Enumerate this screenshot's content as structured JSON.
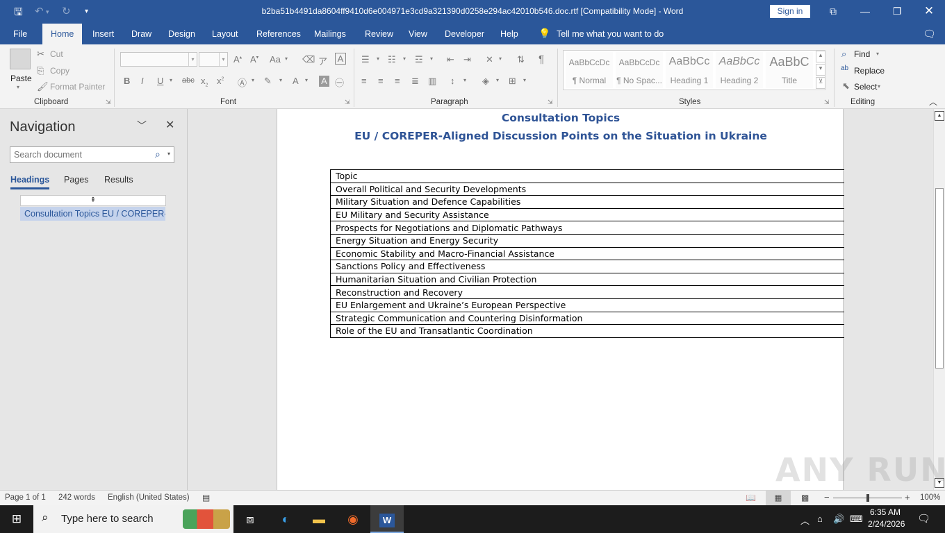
{
  "titlebar": {
    "title": "b2ba51b4491da8604ff9410d6e004971e3cd9a321390d0258e294ac42010b546.doc.rtf  [Compatibility Mode]  -  Word",
    "signin": "Sign in"
  },
  "tabs": [
    "File",
    "Home",
    "Insert",
    "Draw",
    "Design",
    "Layout",
    "References",
    "Mailings",
    "Review",
    "View",
    "Developer",
    "Help"
  ],
  "tell_me": "Tell me what you want to do",
  "ribbon": {
    "clipboard": {
      "label": "Clipboard",
      "paste": "Paste",
      "cut": "Cut",
      "copy": "Copy",
      "format_painter": "Format Painter"
    },
    "font": {
      "label": "Font"
    },
    "paragraph": {
      "label": "Paragraph"
    },
    "styles": {
      "label": "Styles",
      "items": [
        {
          "preview": "AaBbCcDc",
          "name": "¶ Normal"
        },
        {
          "preview": "AaBbCcDc",
          "name": "¶ No Spac..."
        },
        {
          "preview": "AaBbCc",
          "name": "Heading 1"
        },
        {
          "preview": "AaBbCc",
          "name": "Heading 2"
        },
        {
          "preview": "AaBbC",
          "name": "Title"
        }
      ]
    },
    "editing": {
      "label": "Editing",
      "find": "Find",
      "replace": "Replace",
      "select": "Select"
    }
  },
  "nav": {
    "title": "Navigation",
    "search_placeholder": "Search document",
    "tabs": [
      "Headings",
      "Pages",
      "Results"
    ],
    "heading_item": "Consultation Topics EU / COREPER-..."
  },
  "document": {
    "heading1": "Consultation Topics",
    "heading2": "EU / COREPER-Aligned Discussion Points on the Situation in Ukraine",
    "table_rows": [
      "Topic",
      "Overall Political and Security Developments",
      "Military Situation and Defence Capabilities",
      "EU Military and Security Assistance",
      "Prospects for Negotiations and Diplomatic Pathways",
      "Energy Situation and Energy Security",
      "Economic Stability and Macro-Financial Assistance",
      "Sanctions Policy and Effectiveness",
      "Humanitarian Situation and Civilian Protection",
      "Reconstruction and Recovery",
      "EU Enlargement and Ukraine’s European Perspective",
      "Strategic Communication and Countering Disinformation",
      "Role of the EU and Transatlantic Coordination"
    ]
  },
  "watermark": "ANY RUN",
  "status": {
    "page": "Page 1 of 1",
    "words": "242 words",
    "language": "English (United States)",
    "zoom": "100%"
  },
  "taskbar": {
    "search_placeholder": "Type here to search",
    "time": "6:35 AM",
    "date": "2/24/2026"
  }
}
